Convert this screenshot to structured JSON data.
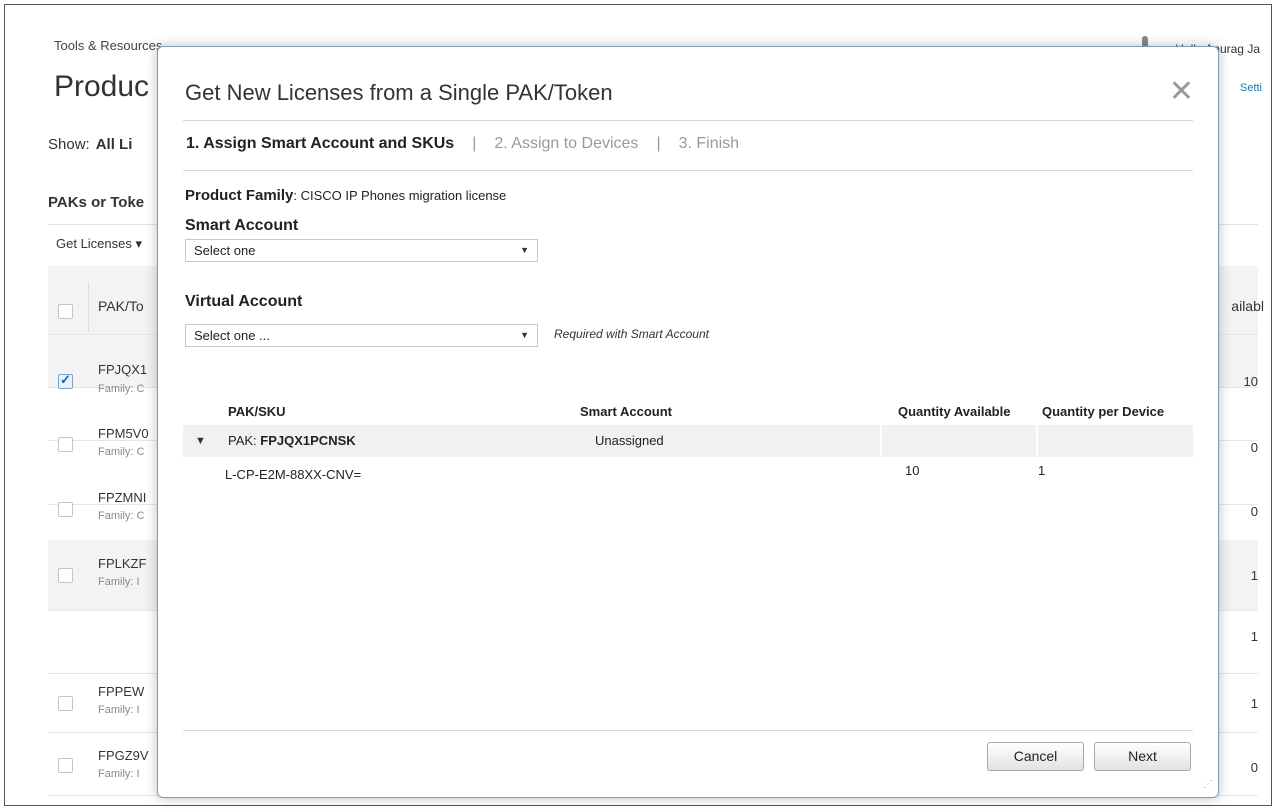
{
  "background_page": {
    "breadcrumb": "Tools & Resources",
    "title": "Produc",
    "user_greeting": "Hello Anurag Ja",
    "settings_link": "Setti",
    "show_label": "Show:",
    "show_value": "All Li",
    "section_title": "PAKs or Toke",
    "get_licenses_menu": "Get Licenses ▾",
    "table": {
      "col_pak": "PAK/To",
      "col_available": "ailabl",
      "rows": [
        {
          "pak": "FPJQX1",
          "family": "Family: C",
          "available": "10",
          "checked": true
        },
        {
          "pak": "FPM5V0",
          "family": "Family: C",
          "available": "0",
          "checked": false
        },
        {
          "pak": "FPZMNI",
          "family": "Family: C",
          "available": "0",
          "checked": false
        },
        {
          "pak": "FPLKZF",
          "family": "Family: I",
          "available": "1",
          "checked": false
        },
        {
          "pak": "",
          "family": "",
          "available": "1",
          "checked": null
        },
        {
          "pak": "FPPEW",
          "family": "Family: I",
          "available": "1",
          "checked": false
        },
        {
          "pak": "FPGZ9V",
          "family": "Family: I",
          "available": "0",
          "checked": false
        }
      ]
    }
  },
  "modal": {
    "title": "Get New Licenses from a Single PAK/Token",
    "close_icon": "close-icon",
    "steps": {
      "step1": "1. Assign Smart Account and SKUs",
      "separator": "|",
      "step2": "2. Assign to Devices",
      "step3": "3. Finish"
    },
    "product_family_label": "Product Family",
    "product_family_value": ": CISCO IP Phones migration license",
    "smart_account": {
      "label": "Smart Account",
      "selected": "Select one"
    },
    "virtual_account": {
      "label": "Virtual Account",
      "selected": "Select one ...",
      "hint": "Required with Smart Account"
    },
    "table": {
      "headers": {
        "pak_sku": "PAK/SKU",
        "smart_account": "Smart Account",
        "quantity_available": "Quantity Available",
        "quantity_per_device": "Quantity per Device"
      },
      "pak_row": {
        "prefix": "PAK: ",
        "pak": "FPJQX1PCNSK",
        "smart_account": "Unassigned"
      },
      "sku_row": {
        "sku": "L-CP-E2M-88XX-CNV=",
        "quantity_available": "10",
        "quantity_per_device": "1"
      }
    },
    "buttons": {
      "cancel": "Cancel",
      "next": "Next"
    }
  },
  "colors": {
    "link": "#1a7ab3",
    "modal_border": "#7d9bbd",
    "row_shade": "#f1f1f1"
  }
}
